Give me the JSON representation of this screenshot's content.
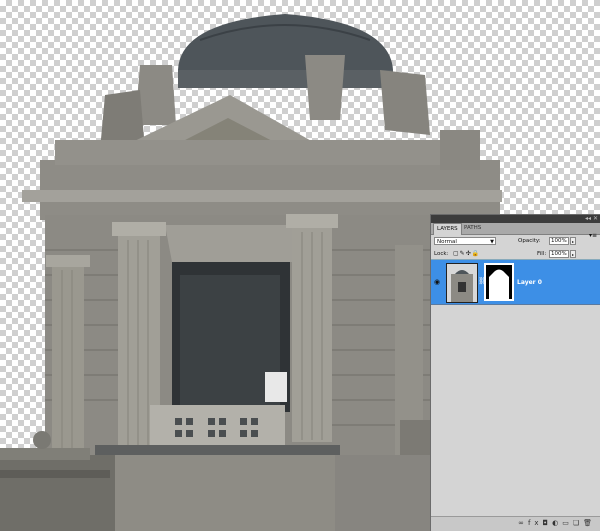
{
  "layers_panel": {
    "tabs": [
      {
        "label": "LAYERS",
        "active": true
      },
      {
        "label": "PATHS",
        "active": false
      }
    ],
    "blend_mode": "Normal",
    "opacity_label": "Opacity:",
    "opacity_value": "100%",
    "lock_label": "Lock:",
    "fill_label": "Fill:",
    "fill_value": "100%",
    "layers": [
      {
        "name": "Layer 0",
        "selected": true,
        "visible": true,
        "has_mask": true
      }
    ],
    "selection_color": "#3d8fe6"
  }
}
